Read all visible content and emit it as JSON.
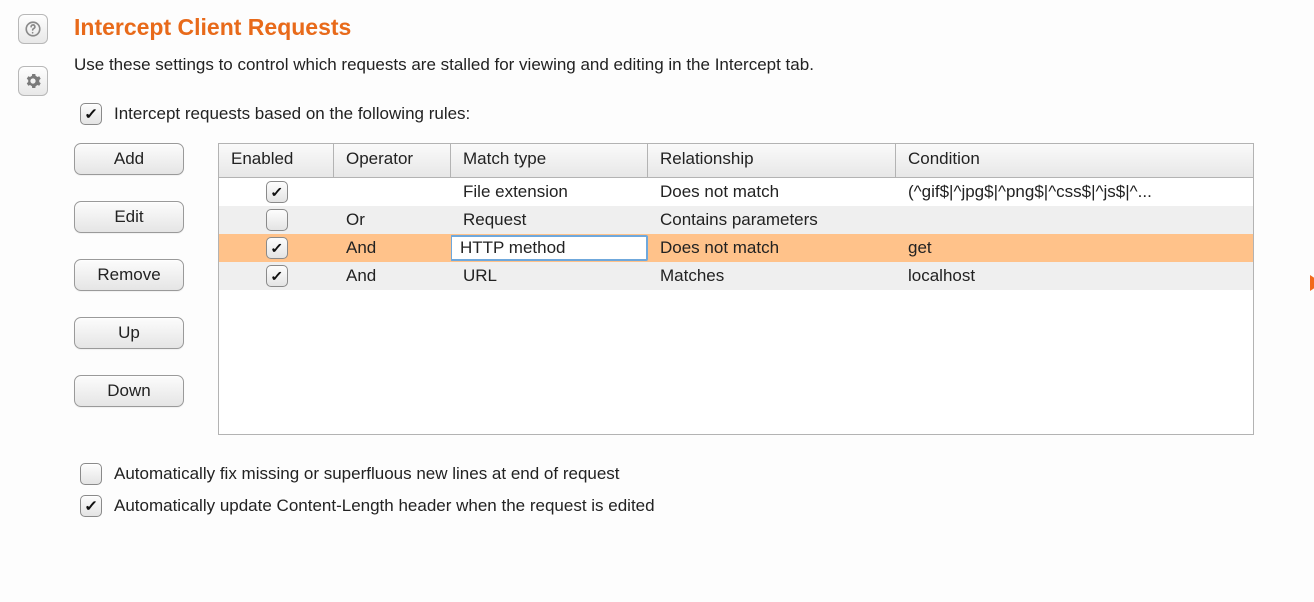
{
  "header": {
    "title": "Intercept Client Requests",
    "description": "Use these settings to control which requests are stalled for viewing and editing in the Intercept tab."
  },
  "intercept_toggle": {
    "checked": true,
    "label": "Intercept requests based on the following rules:"
  },
  "buttons": {
    "add": "Add",
    "edit": "Edit",
    "remove": "Remove",
    "up": "Up",
    "down": "Down"
  },
  "table": {
    "headers": {
      "enabled": "Enabled",
      "operator": "Operator",
      "match_type": "Match type",
      "relationship": "Relationship",
      "condition": "Condition"
    },
    "rows": [
      {
        "enabled": true,
        "operator": "",
        "match_type": "File extension",
        "relationship": "Does not match",
        "condition": "(^gif$|^jpg$|^png$|^css$|^js$|^...",
        "selected": false,
        "editing_match": false
      },
      {
        "enabled": false,
        "operator": "Or",
        "match_type": "Request",
        "relationship": "Contains parameters",
        "condition": "",
        "selected": false,
        "editing_match": false
      },
      {
        "enabled": true,
        "operator": "And",
        "match_type": "HTTP method",
        "relationship": "Does not match",
        "condition": "get",
        "selected": true,
        "editing_match": true
      },
      {
        "enabled": true,
        "operator": "And",
        "match_type": "URL",
        "relationship": "Matches",
        "condition": "localhost",
        "selected": false,
        "editing_match": false
      }
    ]
  },
  "options": {
    "fix_newlines": {
      "checked": false,
      "label": "Automatically fix missing or superfluous new lines at end of request"
    },
    "update_content_length": {
      "checked": true,
      "label": "Automatically update Content-Length header when the request is edited"
    }
  }
}
